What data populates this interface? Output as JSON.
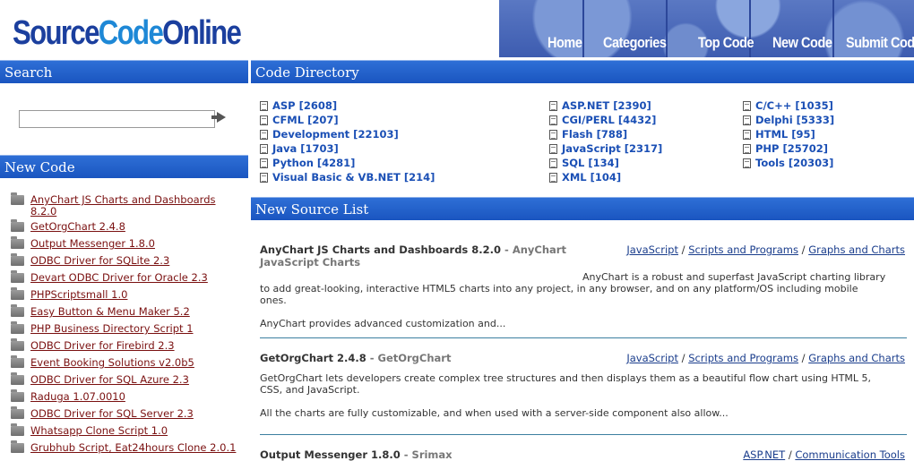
{
  "header": {
    "logo_part1": "Source",
    "logo_part2": "Code",
    "logo_part3": "Online",
    "nav": [
      "Home",
      "Categories",
      "Top Code",
      "New Code",
      "Submit Code"
    ]
  },
  "sidebar": {
    "search_title": "Search",
    "search_placeholder": "",
    "new_code_title": "New Code",
    "items": [
      "AnyChart JS Charts and Dashboards 8.2.0",
      "GetOrgChart 2.4.8",
      "Output Messenger 1.8.0",
      "ODBC Driver for SQLite 2.3",
      "Devart ODBC Driver for Oracle 2.3",
      "PHPScriptsmall 1.0",
      "Easy Button & Menu Maker 5.2",
      "PHP Business Directory Script 1",
      "ODBC Driver for Firebird 2.3",
      "Event Booking Solutions v2.0b5",
      "ODBC Driver for SQL Azure 2.3",
      "Raduga 1.07.0010",
      "ODBC Driver for SQL Server 2.3",
      "Whatsapp Clone Script 1.0",
      "Grubhub Script, Eat24hours Clone 2.0.1"
    ]
  },
  "directory": {
    "title": "Code Directory",
    "col1": [
      "ASP [2608]",
      "CFML [207]",
      "Development [22103]",
      "Java [1703]",
      "Python [4281]",
      "Visual Basic & VB.NET [214]"
    ],
    "col2": [
      "ASP.NET [2390]",
      "CGI/PERL [4432]",
      "Flash [788]",
      "JavaScript [2317]",
      "SQL [134]",
      "XML [104]"
    ],
    "col3": [
      "C/C++ [1035]",
      "Delphi [5333]",
      "HTML [95]",
      "PHP [25702]",
      "Tools [20303]"
    ]
  },
  "source_list": {
    "title": "New Source List",
    "entries": [
      {
        "title": "AnyChart JS Charts and Dashboards 8.2.0",
        "author": "AnyChart",
        "author_line2": "JavaScript Charts",
        "cat1": "JavaScript",
        "cat2": "Scripts and Programs",
        "cat3": "Graphs and Charts",
        "desc_line1": "AnyChart is a robust and superfast JavaScript charting library",
        "desc_line2": "to add great-looking, interactive HTML5 charts into any project, in any browser, and on any platform/OS including mobile",
        "desc_line3": "ones.",
        "desc_line4": "AnyChart provides advanced customization and..."
      },
      {
        "title": "GetOrgChart 2.4.8",
        "author": "GetOrgChart",
        "cat1": "JavaScript",
        "cat2": "Scripts and Programs",
        "cat3": "Graphs and Charts",
        "desc_line1": "GetOrgChart lets developers create complex tree structures and then displays them as a beautiful flow chart using HTML 5,",
        "desc_line2": "CSS, and JavaScript.",
        "desc_line3": "All the charts are fully customizable, and when used with a server-side component also allow..."
      },
      {
        "title": "Output Messenger 1.8.0",
        "author": "Srimax",
        "cat1": "ASP.NET",
        "cat2": "Communication Tools"
      }
    ]
  }
}
